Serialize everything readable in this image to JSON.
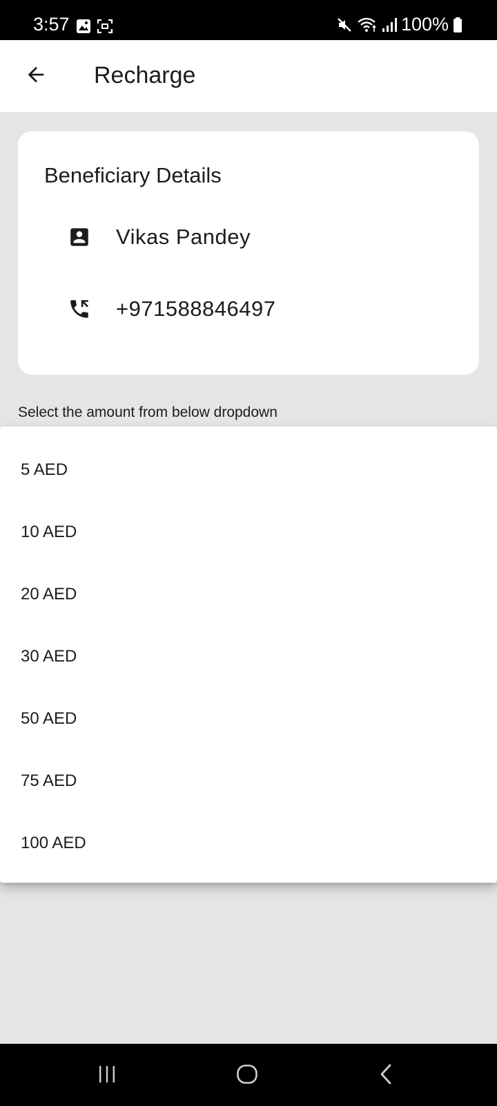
{
  "status_bar": {
    "time": "3:57",
    "battery": "100%",
    "icons": [
      "gallery-icon",
      "screenshot-icon",
      "mute-icon",
      "wifi-icon",
      "signal-icon",
      "battery-icon"
    ]
  },
  "app_bar": {
    "title": "Recharge",
    "back_icon": "arrow-back-icon"
  },
  "beneficiary": {
    "title": "Beneficiary Details",
    "name": "Vikas Pandey",
    "phone": "+971588846497",
    "name_icon": "contact-card-icon",
    "phone_icon": "phone-forward-icon"
  },
  "select_label": "Select the amount from below dropdown",
  "dropdown": {
    "options": [
      "5 AED",
      "10 AED",
      "20 AED",
      "30 AED",
      "50 AED",
      "75 AED",
      "100 AED"
    ]
  },
  "nav_bar": {
    "icons": [
      "recents-icon",
      "home-icon",
      "back-icon"
    ]
  }
}
